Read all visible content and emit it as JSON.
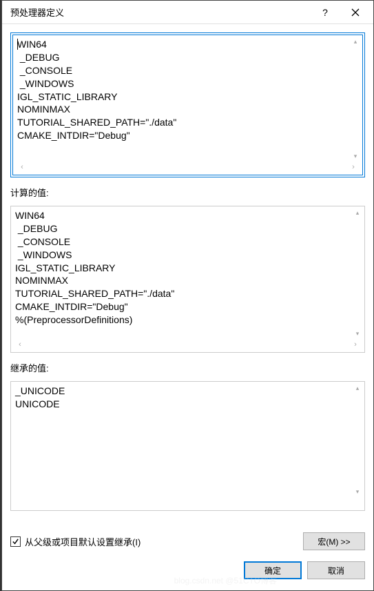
{
  "titlebar": {
    "title": "预处理器定义",
    "help": "?",
    "close": "×"
  },
  "editor": {
    "lines": "WIN64\n _DEBUG\n _CONSOLE\n _WINDOWS\nIGL_STATIC_LIBRARY\nNOMINMAX\nTUTORIAL_SHARED_PATH=\"./data\"\nCMAKE_INTDIR=\"Debug\""
  },
  "computed": {
    "label": "计算的值:",
    "lines": "WIN64\n _DEBUG\n _CONSOLE\n _WINDOWS\nIGL_STATIC_LIBRARY\nNOMINMAX\nTUTORIAL_SHARED_PATH=\"./data\"\nCMAKE_INTDIR=\"Debug\"\n%(PreprocessorDefinitions)"
  },
  "inherited": {
    "label": "继承的值:",
    "lines": "_UNICODE\nUNICODE"
  },
  "checkbox": {
    "label": "从父级或项目默认设置继承(I)",
    "checked": true
  },
  "buttons": {
    "macro": "宏(M) >>",
    "ok": "确定",
    "cancel": "取消"
  },
  "watermark": "blog.csdn.net @51CTO博客"
}
